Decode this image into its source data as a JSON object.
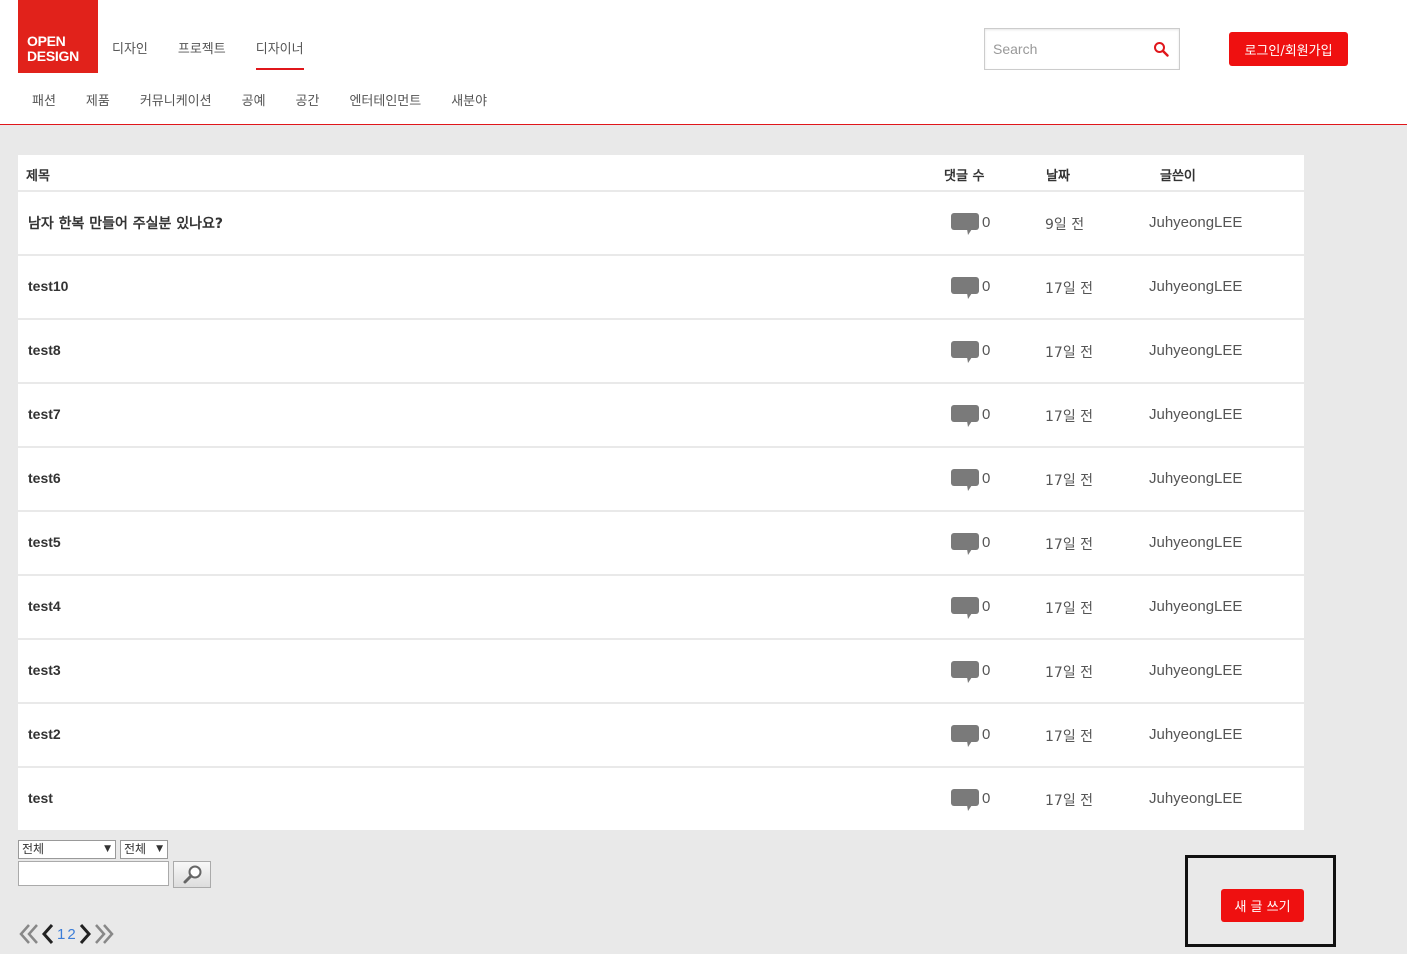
{
  "brand": {
    "logo_line1": "OPEN",
    "logo_line2": "DESIGN",
    "accent": "#e1221b"
  },
  "main_nav": [
    {
      "label": "디자인",
      "active": false
    },
    {
      "label": "프로젝트",
      "active": false
    },
    {
      "label": "디자이너",
      "active": true
    }
  ],
  "sub_nav": [
    "패션",
    "제품",
    "커뮤니케이션",
    "공예",
    "공간",
    "엔터테인먼트",
    "새분야"
  ],
  "search": {
    "placeholder": "Search",
    "icon": "search-icon"
  },
  "auth": {
    "login_label": "로그인/회원가입"
  },
  "board": {
    "headers": {
      "title": "제목",
      "comments": "댓글 수",
      "date": "날짜",
      "author": "글쓴이"
    },
    "rows": [
      {
        "title": "남자 한복 만들어 주실분 있나요?",
        "comments": "0",
        "date": "9일 전",
        "author": "JuhyeongLEE"
      },
      {
        "title": "test10",
        "comments": "0",
        "date": "17일 전",
        "author": "JuhyeongLEE"
      },
      {
        "title": "test8",
        "comments": "0",
        "date": "17일 전",
        "author": "JuhyeongLEE"
      },
      {
        "title": "test7",
        "comments": "0",
        "date": "17일 전",
        "author": "JuhyeongLEE"
      },
      {
        "title": "test6",
        "comments": "0",
        "date": "17일 전",
        "author": "JuhyeongLEE"
      },
      {
        "title": "test5",
        "comments": "0",
        "date": "17일 전",
        "author": "JuhyeongLEE"
      },
      {
        "title": "test4",
        "comments": "0",
        "date": "17일 전",
        "author": "JuhyeongLEE"
      },
      {
        "title": "test3",
        "comments": "0",
        "date": "17일 전",
        "author": "JuhyeongLEE"
      },
      {
        "title": "test2",
        "comments": "0",
        "date": "17일 전",
        "author": "JuhyeongLEE"
      },
      {
        "title": "test",
        "comments": "0",
        "date": "17일 전",
        "author": "JuhyeongLEE"
      }
    ]
  },
  "filters": {
    "scope_selected": "전체",
    "field_selected": "전체",
    "query_value": ""
  },
  "pagination": {
    "pages": [
      "1",
      "2"
    ]
  },
  "write": {
    "label": "새 글 쓰기"
  }
}
